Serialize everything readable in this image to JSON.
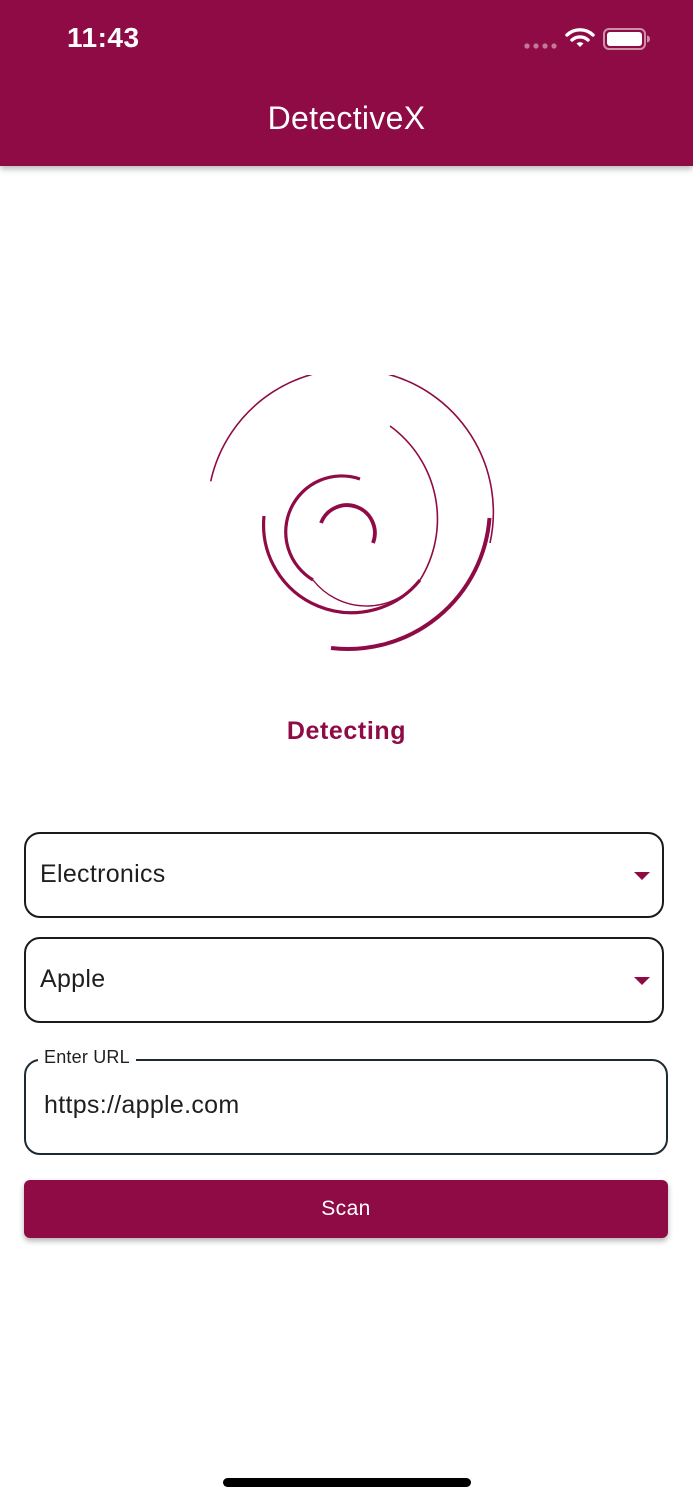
{
  "status_bar": {
    "time": "11:43",
    "icons": [
      "cellular-signal-icon",
      "wifi-icon",
      "battery-icon"
    ]
  },
  "app_bar": {
    "title": "DetectiveX"
  },
  "loader": {
    "icon": "spinner-icon",
    "status_text": "Detecting"
  },
  "form": {
    "category_select": {
      "value": "Electronics",
      "icon": "caret-down-icon"
    },
    "brand_select": {
      "value": "Apple",
      "icon": "caret-down-icon"
    },
    "url_input": {
      "label": "Enter URL",
      "value": "https://apple.com"
    },
    "scan_button": {
      "label": "Scan"
    }
  },
  "colors": {
    "primary": "#8f0b45",
    "background": "#ffffff",
    "text": "#1f1f1f"
  }
}
